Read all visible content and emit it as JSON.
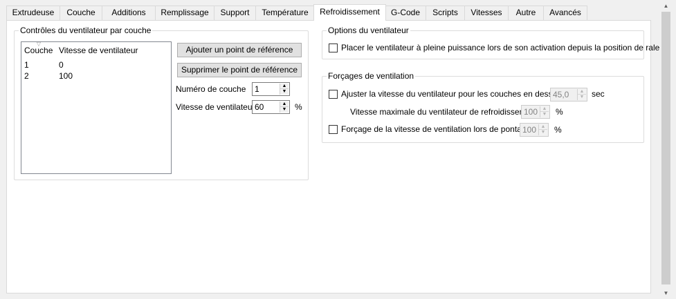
{
  "tabs": [
    {
      "label": "Extrudeuse"
    },
    {
      "label": "Couche"
    },
    {
      "label": "Additions"
    },
    {
      "label": "Remplissage"
    },
    {
      "label": "Support"
    },
    {
      "label": "Température"
    },
    {
      "label": "Refroidissement"
    },
    {
      "label": "G-Code"
    },
    {
      "label": "Scripts"
    },
    {
      "label": "Vitesses"
    },
    {
      "label": "Autre"
    },
    {
      "label": "Avancés"
    }
  ],
  "active_tab": "Refroidissement",
  "fan_controls": {
    "title": "Contrôles du ventilateur par couche",
    "columns": [
      "Couche",
      "Vitesse de ventilateur"
    ],
    "rows": [
      [
        "1",
        "0"
      ],
      [
        "2",
        "100"
      ]
    ],
    "add_button": "Ajouter un point de référence",
    "remove_button": "Supprimer le point de référence",
    "layer_label": "Numéro de couche",
    "layer_value": "1",
    "speed_label": "Vitesse de ventilateur",
    "speed_value": "60",
    "speed_unit": "%"
  },
  "fan_options": {
    "title": "Options du ventilateur",
    "full_power_label": "Placer le ventilateur à pleine puissance lors de son activation depuis la position de ralenti",
    "full_power_checked": false
  },
  "overrides": {
    "title": "Forçages de ventilation",
    "adjust_label": "Ajuster la vitesse du ventilateur pour les couches en dessous",
    "adjust_checked": false,
    "adjust_value": "45,0",
    "adjust_unit": "sec",
    "max_speed_label": "Vitesse maximale du ventilateur de refroidissement",
    "max_speed_value": "100",
    "max_speed_unit": "%",
    "bridge_label": "Forçage de la vitesse de ventilation lors de pontage",
    "bridge_checked": false,
    "bridge_value": "100",
    "bridge_unit": "%"
  },
  "icons": {
    "spin_up": "spin-up-arrow",
    "spin_down": "spin-down-arrow",
    "sort": "sort-indicator",
    "scroll_up": "scroll-up-arrow",
    "scroll_down": "scroll-down-arrow"
  }
}
